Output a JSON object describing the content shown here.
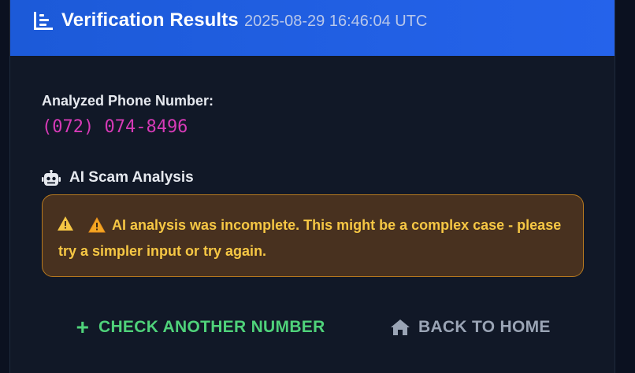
{
  "header": {
    "title": "Verification Results",
    "timestamp": "2025-08-29 16:46:04 UTC",
    "icon": "chart-bar-icon"
  },
  "phone": {
    "label": "Analyzed Phone Number:",
    "value": "(072) 074-8496",
    "color": "#d63ab7"
  },
  "ai_analysis": {
    "title": "AI Scam Analysis",
    "icon": "robot-icon",
    "warning_text": "AI analysis was incomplete. This might be a complex case - please try a simpler input or try again.",
    "warning_icons": [
      "warning-triangle-icon",
      "warning-triangle-icon"
    ]
  },
  "actions": {
    "check_another_label": "CHECK ANOTHER NUMBER",
    "check_another_icon": "plus-icon",
    "back_home_label": "BACK TO HOME",
    "back_home_icon": "home-icon"
  },
  "colors": {
    "header_bg": "#2563eb",
    "card_bg": "#111827",
    "warning_bg": "#48311f",
    "warning_border": "#b7791f",
    "warning_text": "#f6c744",
    "success": "#4fd27a",
    "muted": "#9aa4b5"
  }
}
